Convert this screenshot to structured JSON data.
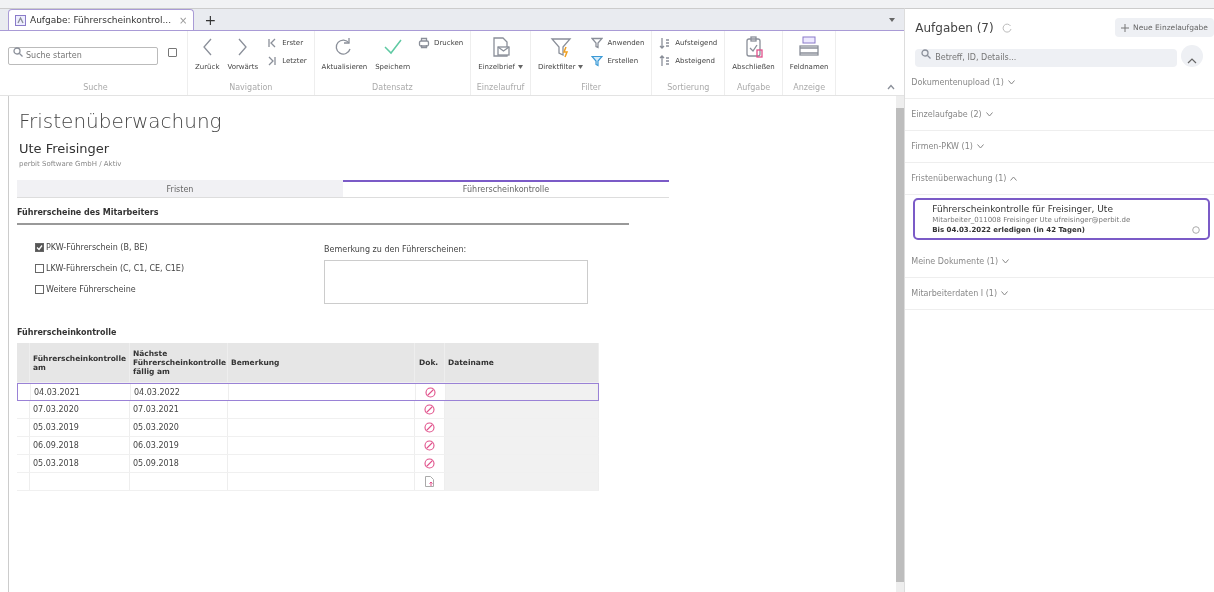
{
  "tabs": [
    {
      "label": "Aufgabe: Führerscheinkontrol...",
      "close": "×"
    }
  ],
  "new_tab": "+",
  "ribbon": [
    {
      "label": "Suche",
      "items": [
        {
          "kind": "search",
          "placeholder": "Suche starten"
        },
        {
          "kind": "checkbox",
          "checked": false
        }
      ]
    },
    {
      "label": "Navigation",
      "items": [
        {
          "kind": "large",
          "label": "Zurück"
        },
        {
          "kind": "large",
          "label": "Vorwärts"
        },
        {
          "kind": "stack",
          "items": [
            {
              "label": "Erster"
            },
            {
              "label": "Letzter"
            }
          ]
        }
      ]
    },
    {
      "label": "Datensatz",
      "items": [
        {
          "kind": "large",
          "label": "Aktualisieren"
        },
        {
          "kind": "large",
          "label": "Speichern"
        },
        {
          "kind": "stack",
          "items": [
            {
              "label": "Drucken"
            }
          ]
        }
      ]
    },
    {
      "label": "Einzelaufruf",
      "items": [
        {
          "kind": "large",
          "label": "Einzelbrief",
          "dropdown": true
        }
      ]
    },
    {
      "label": "Filter",
      "items": [
        {
          "kind": "large",
          "label": "Direktfilter",
          "dropdown": true
        },
        {
          "kind": "stack",
          "items": [
            {
              "label": "Anwenden"
            },
            {
              "label": "Erstellen"
            }
          ]
        }
      ]
    },
    {
      "label": "Sortierung",
      "items": [
        {
          "kind": "stack",
          "items": [
            {
              "label": "Aufsteigend"
            },
            {
              "label": "Absteigend"
            }
          ]
        }
      ]
    },
    {
      "label": "Aufgabe",
      "items": [
        {
          "kind": "large",
          "label": "Abschließen"
        }
      ]
    },
    {
      "label": "Anzeige",
      "items": [
        {
          "kind": "large",
          "label": "Feldnamen"
        }
      ]
    }
  ],
  "page": {
    "title": "Fristenüberwachung",
    "person": "Ute Freisinger",
    "subtitle": "perbit Software GmbH / Aktiv",
    "tabs": [
      {
        "label": "Fristen",
        "selected": false
      },
      {
        "label": "Führerscheinkontrolle",
        "selected": true
      }
    ],
    "licenses_heading": "Führerscheine des Mitarbeiters",
    "licenses": [
      {
        "label": "PKW-Führerschein (B, BE)",
        "checked": true
      },
      {
        "label": "LKW-Führerschein (C, C1, CE, C1E)",
        "checked": false
      },
      {
        "label": "Weitere Führerscheine",
        "checked": false
      }
    ],
    "remark_label": "Bemerkung zu den Führerscheinen:",
    "control_heading": "Führerscheinkontrolle",
    "table": {
      "columns": [
        "Führerscheinkontrolle am",
        "Nächste Führerscheinkontrolle fällig am",
        "Bemerkung",
        "Dok.",
        "Dateiname"
      ],
      "rows": [
        {
          "kind": "blocked",
          "checked_on": "04.03.2021",
          "due_on": "04.03.2022",
          "selected": true
        },
        {
          "kind": "blocked",
          "checked_on": "07.03.2020",
          "due_on": "07.03.2021",
          "selected": false
        },
        {
          "kind": "blocked",
          "checked_on": "05.03.2019",
          "due_on": "05.03.2020",
          "selected": false
        },
        {
          "kind": "blocked",
          "checked_on": "06.09.2018",
          "due_on": "06.03.2019",
          "selected": false
        },
        {
          "kind": "blocked",
          "checked_on": "05.03.2018",
          "due_on": "05.09.2018",
          "selected": false
        },
        {
          "kind": "upload",
          "selected": false
        }
      ]
    }
  },
  "tasks_panel": {
    "title": "Aufgaben (7)",
    "new_button": "Neue Einzelaufgabe",
    "search_placeholder": "Betreff, ID, Details...",
    "groups": [
      {
        "label": "Dokumentenupload (1)",
        "expanded": false
      },
      {
        "label": "Einzelaufgabe (2)",
        "expanded": false
      },
      {
        "label": "Firmen-PKW (1)",
        "expanded": false
      },
      {
        "label": "Fristenüberwachung (1)",
        "expanded": true,
        "tasks": [
          {
            "title": "Führerscheinkontrolle für Freisinger, Ute",
            "meta": "Mitarbeiter_011008 Freisinger Ute ufreisinger@perbit.de",
            "due": "Bis 04.03.2022 erledigen (in 42 Tagen)",
            "selected": true
          }
        ]
      },
      {
        "label": "Meine Dokumente (1)",
        "expanded": false
      },
      {
        "label": "Mitarbeiterdaten I (1)",
        "expanded": false
      }
    ]
  }
}
